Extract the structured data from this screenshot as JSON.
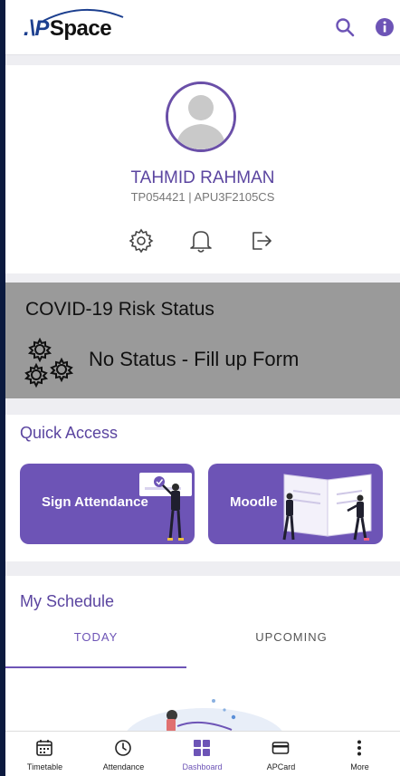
{
  "header": {
    "logo_prefix": ".\\P",
    "logo_text": "Space",
    "icons": [
      "search-icon",
      "info-icon"
    ]
  },
  "profile": {
    "name": "TAHMID RAHMAN",
    "subtitle": "TP054421 | APU3F2105CS",
    "actions": [
      "settings-icon",
      "notification-bell-icon",
      "logout-icon"
    ]
  },
  "covid": {
    "title": "COVID-19 Risk Status",
    "status": "No Status - Fill up Form"
  },
  "quick_access": {
    "title": "Quick Access",
    "tiles": [
      {
        "label": "Sign Attendance"
      },
      {
        "label": "Moodle"
      }
    ]
  },
  "schedule": {
    "title": "My Schedule",
    "tabs": [
      {
        "label": "TODAY",
        "active": true
      },
      {
        "label": "UPCOMING",
        "active": false
      }
    ]
  },
  "bottom_nav": {
    "items": [
      {
        "label": "Timetable",
        "icon": "calendar-icon"
      },
      {
        "label": "Attendance",
        "icon": "clock-icon"
      },
      {
        "label": "Dashboard",
        "icon": "dashboard-icon",
        "active": true
      },
      {
        "label": "APCard",
        "icon": "card-icon"
      },
      {
        "label": "More",
        "icon": "more-vertical-icon"
      }
    ]
  },
  "colors": {
    "accent": "#6d54b6",
    "name": "#5b45a0",
    "covid_bg": "#9a9a9a",
    "background": "#eeeef2"
  }
}
